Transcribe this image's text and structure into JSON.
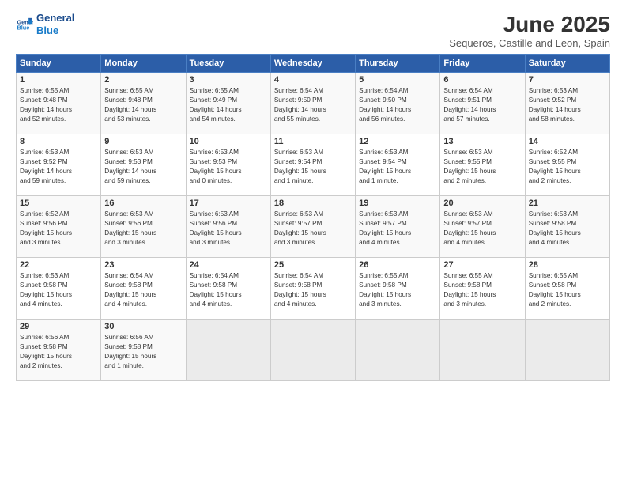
{
  "header": {
    "logo_line1": "General",
    "logo_line2": "Blue",
    "month_year": "June 2025",
    "location": "Sequeros, Castille and Leon, Spain"
  },
  "weekdays": [
    "Sunday",
    "Monday",
    "Tuesday",
    "Wednesday",
    "Thursday",
    "Friday",
    "Saturday"
  ],
  "rows": [
    [
      {
        "day": "1",
        "info": "Sunrise: 6:55 AM\nSunset: 9:48 PM\nDaylight: 14 hours\nand 52 minutes."
      },
      {
        "day": "2",
        "info": "Sunrise: 6:55 AM\nSunset: 9:48 PM\nDaylight: 14 hours\nand 53 minutes."
      },
      {
        "day": "3",
        "info": "Sunrise: 6:55 AM\nSunset: 9:49 PM\nDaylight: 14 hours\nand 54 minutes."
      },
      {
        "day": "4",
        "info": "Sunrise: 6:54 AM\nSunset: 9:50 PM\nDaylight: 14 hours\nand 55 minutes."
      },
      {
        "day": "5",
        "info": "Sunrise: 6:54 AM\nSunset: 9:50 PM\nDaylight: 14 hours\nand 56 minutes."
      },
      {
        "day": "6",
        "info": "Sunrise: 6:54 AM\nSunset: 9:51 PM\nDaylight: 14 hours\nand 57 minutes."
      },
      {
        "day": "7",
        "info": "Sunrise: 6:53 AM\nSunset: 9:52 PM\nDaylight: 14 hours\nand 58 minutes."
      }
    ],
    [
      {
        "day": "8",
        "info": "Sunrise: 6:53 AM\nSunset: 9:52 PM\nDaylight: 14 hours\nand 59 minutes."
      },
      {
        "day": "9",
        "info": "Sunrise: 6:53 AM\nSunset: 9:53 PM\nDaylight: 14 hours\nand 59 minutes."
      },
      {
        "day": "10",
        "info": "Sunrise: 6:53 AM\nSunset: 9:53 PM\nDaylight: 15 hours\nand 0 minutes."
      },
      {
        "day": "11",
        "info": "Sunrise: 6:53 AM\nSunset: 9:54 PM\nDaylight: 15 hours\nand 1 minute."
      },
      {
        "day": "12",
        "info": "Sunrise: 6:53 AM\nSunset: 9:54 PM\nDaylight: 15 hours\nand 1 minute."
      },
      {
        "day": "13",
        "info": "Sunrise: 6:53 AM\nSunset: 9:55 PM\nDaylight: 15 hours\nand 2 minutes."
      },
      {
        "day": "14",
        "info": "Sunrise: 6:52 AM\nSunset: 9:55 PM\nDaylight: 15 hours\nand 2 minutes."
      }
    ],
    [
      {
        "day": "15",
        "info": "Sunrise: 6:52 AM\nSunset: 9:56 PM\nDaylight: 15 hours\nand 3 minutes."
      },
      {
        "day": "16",
        "info": "Sunrise: 6:53 AM\nSunset: 9:56 PM\nDaylight: 15 hours\nand 3 minutes."
      },
      {
        "day": "17",
        "info": "Sunrise: 6:53 AM\nSunset: 9:56 PM\nDaylight: 15 hours\nand 3 minutes."
      },
      {
        "day": "18",
        "info": "Sunrise: 6:53 AM\nSunset: 9:57 PM\nDaylight: 15 hours\nand 3 minutes."
      },
      {
        "day": "19",
        "info": "Sunrise: 6:53 AM\nSunset: 9:57 PM\nDaylight: 15 hours\nand 4 minutes."
      },
      {
        "day": "20",
        "info": "Sunrise: 6:53 AM\nSunset: 9:57 PM\nDaylight: 15 hours\nand 4 minutes."
      },
      {
        "day": "21",
        "info": "Sunrise: 6:53 AM\nSunset: 9:58 PM\nDaylight: 15 hours\nand 4 minutes."
      }
    ],
    [
      {
        "day": "22",
        "info": "Sunrise: 6:53 AM\nSunset: 9:58 PM\nDaylight: 15 hours\nand 4 minutes."
      },
      {
        "day": "23",
        "info": "Sunrise: 6:54 AM\nSunset: 9:58 PM\nDaylight: 15 hours\nand 4 minutes."
      },
      {
        "day": "24",
        "info": "Sunrise: 6:54 AM\nSunset: 9:58 PM\nDaylight: 15 hours\nand 4 minutes."
      },
      {
        "day": "25",
        "info": "Sunrise: 6:54 AM\nSunset: 9:58 PM\nDaylight: 15 hours\nand 4 minutes."
      },
      {
        "day": "26",
        "info": "Sunrise: 6:55 AM\nSunset: 9:58 PM\nDaylight: 15 hours\nand 3 minutes."
      },
      {
        "day": "27",
        "info": "Sunrise: 6:55 AM\nSunset: 9:58 PM\nDaylight: 15 hours\nand 3 minutes."
      },
      {
        "day": "28",
        "info": "Sunrise: 6:55 AM\nSunset: 9:58 PM\nDaylight: 15 hours\nand 2 minutes."
      }
    ],
    [
      {
        "day": "29",
        "info": "Sunrise: 6:56 AM\nSunset: 9:58 PM\nDaylight: 15 hours\nand 2 minutes."
      },
      {
        "day": "30",
        "info": "Sunrise: 6:56 AM\nSunset: 9:58 PM\nDaylight: 15 hours\nand 1 minute."
      },
      {
        "day": "",
        "info": ""
      },
      {
        "day": "",
        "info": ""
      },
      {
        "day": "",
        "info": ""
      },
      {
        "day": "",
        "info": ""
      },
      {
        "day": "",
        "info": ""
      }
    ]
  ]
}
